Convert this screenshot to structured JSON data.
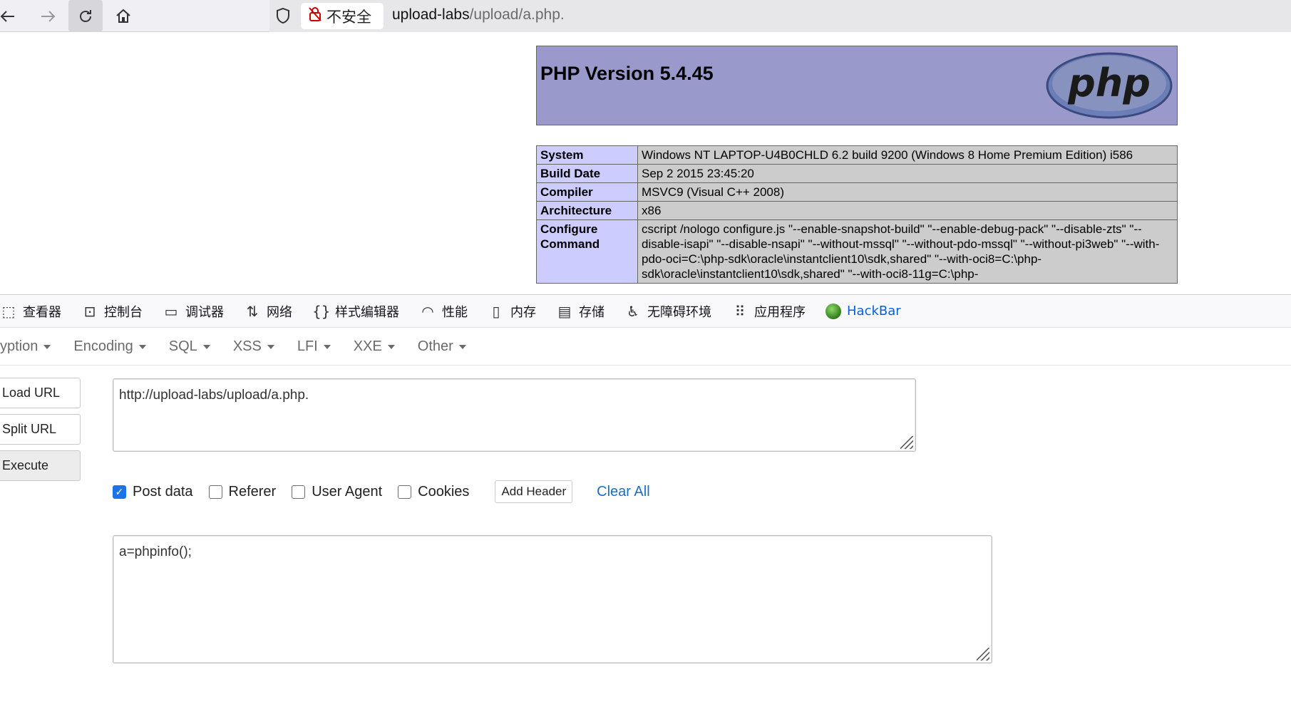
{
  "browser": {
    "insecure_label": "不安全",
    "url_host": "upload-labs",
    "url_path": "/upload/a.php."
  },
  "phpinfo": {
    "title": "PHP Version 5.4.45",
    "logo_text": "php",
    "rows": [
      {
        "key": "System",
        "value": "Windows NT LAPTOP-U4B0CHLD 6.2 build 9200 (Windows 8 Home Premium Edition) i586"
      },
      {
        "key": "Build Date",
        "value": "Sep 2 2015 23:45:20"
      },
      {
        "key": "Compiler",
        "value": "MSVC9 (Visual C++ 2008)"
      },
      {
        "key": "Architecture",
        "value": "x86"
      },
      {
        "key": "Configure Command",
        "value": "cscript /nologo configure.js \"--enable-snapshot-build\" \"--enable-debug-pack\" \"--disable-zts\" \"--disable-isapi\" \"--disable-nsapi\" \"--without-mssql\" \"--without-pdo-mssql\" \"--without-pi3web\" \"--with-pdo-oci=C:\\php-sdk\\oracle\\instantclient10\\sdk,shared\" \"--with-oci8=C:\\php-sdk\\oracle\\instantclient10\\sdk,shared\" \"--with-oci8-11g=C:\\php-"
      }
    ]
  },
  "devtools": {
    "tabs": [
      {
        "label": "查看器",
        "icon": "inspector-icon"
      },
      {
        "label": "控制台",
        "icon": "console-icon"
      },
      {
        "label": "调试器",
        "icon": "debugger-icon"
      },
      {
        "label": "网络",
        "icon": "network-icon"
      },
      {
        "label": "样式编辑器",
        "icon": "style-editor-icon"
      },
      {
        "label": "性能",
        "icon": "performance-icon"
      },
      {
        "label": "内存",
        "icon": "memory-icon"
      },
      {
        "label": "存储",
        "icon": "storage-icon"
      },
      {
        "label": "无障碍环境",
        "icon": "accessibility-icon"
      },
      {
        "label": "应用程序",
        "icon": "application-icon"
      },
      {
        "label": "HackBar",
        "icon": "hackbar-icon"
      }
    ]
  },
  "hackbar": {
    "menu": [
      "yption",
      "Encoding",
      "SQL",
      "XSS",
      "LFI",
      "XXE",
      "Other"
    ],
    "load_url": "Load URL",
    "split_url": "Split URL",
    "execute": "Execute",
    "url_value": "http://upload-labs/upload/a.php.",
    "options": {
      "post_data": "Post data",
      "referer": "Referer",
      "user_agent": "User Agent",
      "cookies": "Cookies"
    },
    "post_data_checked": true,
    "add_header": "Add Header",
    "clear_all": "Clear All",
    "post_body": "a=phpinfo();"
  },
  "colors": {
    "php_header": "#9999cc",
    "php_key": "#ccccff",
    "php_value": "#cccccc",
    "accent": "#1a73e8"
  }
}
